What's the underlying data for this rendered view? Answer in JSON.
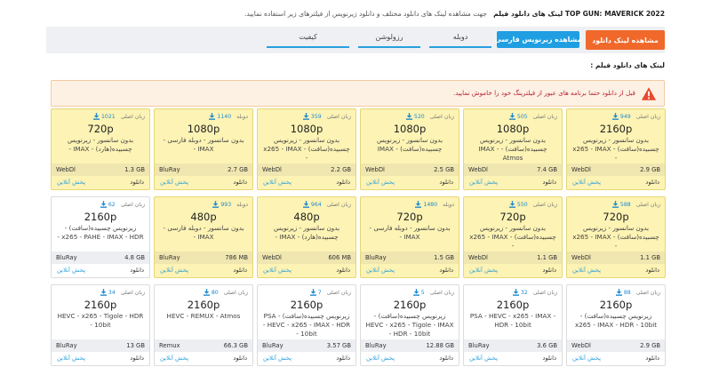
{
  "header": {
    "movie": "TOP GUN: MAVERICK 2022 لینک های دانلود فیلم",
    "description": "جهت مشاهده لینک های دانلود مختلف و دانلود زیرنویس از فیلترهای زیر استفاده نمایید."
  },
  "toolbar": {
    "download_links_button": "مشاهده لینک دانلود",
    "persian_subtitle_button": "مشاهده زیرنویس فارسی",
    "filter_dub": "دوبله",
    "filter_resolution": "رزولوشن",
    "filter_quality": "کیفیت"
  },
  "section": {
    "title": "لینک های دانلود فیلم :"
  },
  "warning": {
    "text": "قبل از دانلود حتما برنامه های عبور از فیلترینگ خود را خاموش نمایید."
  },
  "actions": {
    "download": "دانلود",
    "stream": "پخش آنلاین"
  },
  "cards": [
    {
      "lang": "زبان اصلی",
      "count": "949",
      "res": "2160p",
      "desc": "بدون سانسور - زیرنویس چسبیده(سافت) - x265 - IMAX -",
      "source": "WebDl",
      "size": "2.9 GB",
      "hl": true
    },
    {
      "lang": "زبان اصلی",
      "count": "505",
      "res": "1080p",
      "desc": "بدون سانسور - زیرنویس چسبیده(سافت) - IMAX - Atmos",
      "source": "WebDl",
      "size": "7.4 GB",
      "hl": true
    },
    {
      "lang": "زبان اصلی",
      "count": "520",
      "res": "1080p",
      "desc": "بدون سانسور - زیرنویس چسبیده(سافت) - IMAX",
      "source": "WebDl",
      "size": "2.5 GB",
      "hl": true
    },
    {
      "lang": "زبان اصلی",
      "count": "359",
      "res": "1080p",
      "desc": "بدون سانسور - زیرنویس چسبیده(سافت) - x265 - IMAX -",
      "source": "WebDl",
      "size": "2.2 GB",
      "hl": true
    },
    {
      "lang": "دوبله",
      "count": "1140",
      "res": "1080p",
      "desc": "بدون سانسور - دوبله فارسی - IMAX -",
      "source": "BluRay",
      "size": "2.7 GB",
      "hl": true
    },
    {
      "lang": "زبان اصلی",
      "count": "1021",
      "res": "720p",
      "desc": "بدون سانسور - زیرنویس چسبیده(هارد) - IMAX -",
      "source": "WebDl",
      "size": "1.3 GB",
      "hl": true
    },
    {
      "lang": "زبان اصلی",
      "count": "588",
      "res": "720p",
      "desc": "بدون سانسور - زیرنویس چسبیده(سافت) - x265 - IMAX -",
      "source": "WebDl",
      "size": "1.1 GB",
      "hl": true
    },
    {
      "lang": "زبان اصلی",
      "count": "550",
      "res": "720p",
      "desc": "بدون سانسور - زیرنویس چسبیده(سافت) - x265 - IMAX -",
      "source": "WebDl",
      "size": "1.1 GB",
      "hl": true
    },
    {
      "lang": "دوبله",
      "count": "1480",
      "res": "720p",
      "desc": "بدون سانسور - دوبله فارسی - IMAX -",
      "source": "BluRay",
      "size": "1.5 GB",
      "hl": true
    },
    {
      "lang": "زبان اصلی",
      "count": "964",
      "res": "480p",
      "desc": "بدون سانسور - زیرنویس چسبیده(هارد) - IMAX -",
      "source": "WebDl",
      "size": "606 MB",
      "hl": true
    },
    {
      "lang": "دوبله",
      "count": "993",
      "res": "480p",
      "desc": "بدون سانسور - دوبله فارسی - IMAX -",
      "source": "BluRay",
      "size": "786 MB",
      "hl": true
    },
    {
      "lang": "زبان اصلی",
      "count": "62",
      "res": "2160p",
      "desc": "زیرنویس چسبیده(سافت) - x265 - PAHE - IMAX - HDR -",
      "source": "BluRay",
      "size": "4.8 GB",
      "hl": false
    },
    {
      "lang": "زبان اصلی",
      "count": "88",
      "res": "2160p",
      "desc": "زیرنویس چسبیده(سافت) - x265 - IMAX - HDR - 10bit",
      "source": "WebDl",
      "size": "2.9 GB",
      "hl": false
    },
    {
      "lang": "زبان اصلی",
      "count": "32",
      "res": "2160p",
      "desc": "PSA - HEVC - x265 - IMAX - HDR - 10bit",
      "source": "BluRay",
      "size": "3.6 GB",
      "hl": false
    },
    {
      "lang": "زبان اصلی",
      "count": "5",
      "res": "2160p",
      "desc": "زیرنویس چسبیده(سافت) - HEVC - x265 - Tigole - IMAX - HDR - 10bit",
      "source": "BluRay",
      "size": "12.88 GB",
      "hl": false
    },
    {
      "lang": "زبان اصلی",
      "count": "7",
      "res": "2160p",
      "desc": "زیرنویس چسبیده(سافت) - PSA - HEVC - x265 - IMAX - HDR - 10bit",
      "source": "BluRay",
      "size": "3.57 GB",
      "hl": false
    },
    {
      "lang": "زبان اصلی",
      "count": "80",
      "res": "2160p",
      "desc": "HEVC - REMUX - Atmos",
      "source": "Remux",
      "size": "66.3 GB",
      "hl": false
    },
    {
      "lang": "زبان اصلی",
      "count": "34",
      "res": "2160p",
      "desc": "HEVC - x265 - Tigole - HDR - 10bit",
      "source": "BluRay",
      "size": "13 GB",
      "hl": false
    }
  ],
  "colors": {
    "accent_orange": "#f0682a",
    "accent_blue": "#1f9fe2",
    "highlight": "#fdf3b4"
  }
}
